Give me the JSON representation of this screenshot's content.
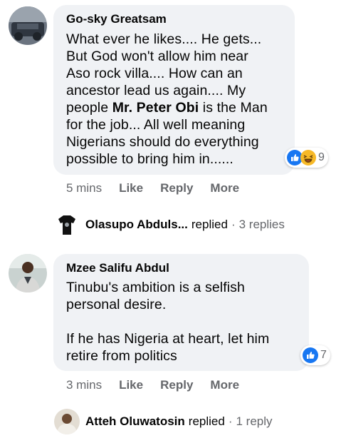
{
  "comments": [
    {
      "author": "Go-sky Greatsam",
      "text_before": "What ever he likes.... He gets...\nBut God won't allow him near\nAso rock villa.... How can an\nancestor lead us again.... My\npeople ",
      "text_bold": "Mr. Peter Obi",
      "text_after": " is the Man\nfor the job... All well meaning\nNigerians should do everything\npossible to bring him in......",
      "reactions": {
        "icons": [
          "like-icon",
          "haha-icon"
        ],
        "count": "9"
      },
      "time": "5 mins",
      "actions": [
        "Like",
        "Reply",
        "More"
      ],
      "replies_preview": {
        "name": "Olasupo Abduls...",
        "verb": "replied",
        "separator": "·",
        "count": "3 replies"
      }
    },
    {
      "author": "Mzee Salifu Abdul",
      "text": "Tinubu's ambition is a selfish\npersonal desire.\n\nIf he has Nigeria at heart, let him\nretire from politics",
      "reactions": {
        "icons": [
          "like-icon"
        ],
        "count": "7"
      },
      "time": "3 mins",
      "actions": [
        "Like",
        "Reply",
        "More"
      ],
      "replies_preview": {
        "name": "Atteh Oluwatosin",
        "verb": "replied",
        "separator": "·",
        "count": "1 reply"
      }
    }
  ],
  "colors": {
    "bubble": "#f0f2f5",
    "secondary_text": "#65676b",
    "like_blue": "#1877f2",
    "haha_yellow": "#f7b928"
  }
}
